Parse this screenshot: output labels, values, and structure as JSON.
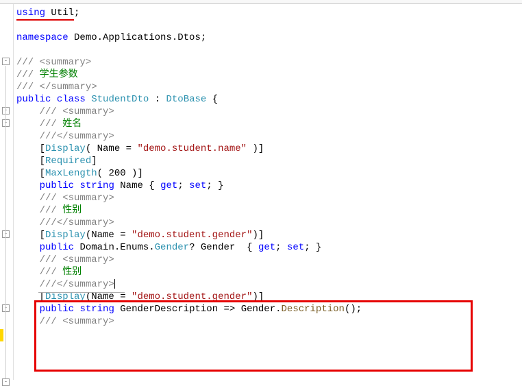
{
  "code": {
    "using_kw": "using",
    "using_ns": "Util",
    "semicolon": ";",
    "namespace_kw": "namespace",
    "namespace_name": "Demo.Applications.Dtos",
    "summary_open": "/// <summary>",
    "summary_close": "/// </summary>",
    "summary_close2": "///</summary>",
    "comment_prefix": "/// ",
    "student_param": "学生参数",
    "public_kw": "public",
    "class_kw": "class",
    "student_dto": "StudentDto",
    "colon": " : ",
    "dto_base": "DtoBase",
    "brace_open": " {",
    "name_label": "姓名",
    "gender_label": "性别",
    "display_attr": "Display",
    "name_param": "( Name = ",
    "name_param2": "(Name = ",
    "name_str": "\"demo.student.name\"",
    "gender_str": "\"demo.student.gender\"",
    "attr_close": " )]",
    "attr_close2": ")]",
    "required_attr": "Required",
    "maxlength_attr": "MaxLength",
    "maxlength_val": "( 200 )]",
    "string_kw": "string",
    "name_prop": "Name",
    "get_kw": "get",
    "set_kw": "set",
    "prop_body": " { ",
    "prop_sep": "; ",
    "prop_end": "; }",
    "domain_enums": "Domain.Enums.",
    "gender_type": "Gender",
    "nullable": "?",
    "gender_prop": "Gender",
    "gender_desc_prop": "GenderDescription",
    "arrow": " => ",
    "gender_ref": "Gender.",
    "description_method": "Description",
    "call_end": "();",
    "lbracket": "[",
    "rbracket": "]"
  }
}
